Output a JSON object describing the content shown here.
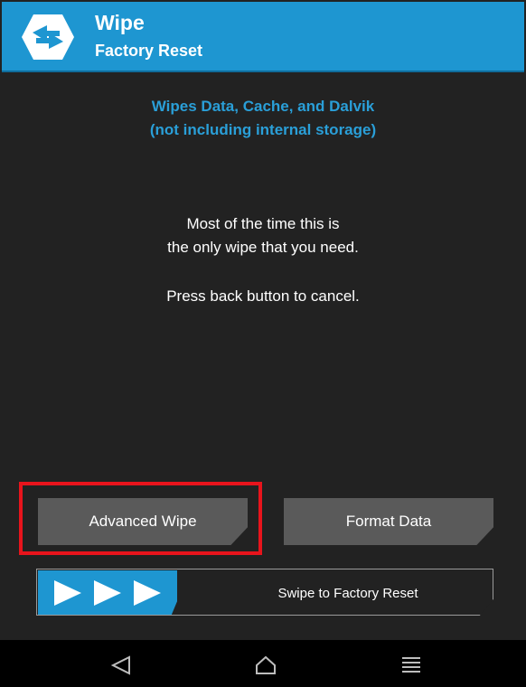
{
  "header": {
    "title": "Wipe",
    "subtitle": "Factory Reset",
    "logo_icon": "twrp-logo-icon"
  },
  "info": {
    "line1": "Wipes Data, Cache, and Dalvik",
    "line2": "(not including internal storage)"
  },
  "message": {
    "line1": "Most of the time this is",
    "line2": "the only wipe that you need.",
    "line3": "Press back button to cancel."
  },
  "buttons": {
    "advanced_wipe": "Advanced Wipe",
    "format_data": "Format Data"
  },
  "swipe": {
    "label": "Swipe to Factory Reset",
    "icon": "triple-arrow-icon"
  },
  "navbar": {
    "back_icon": "back-icon",
    "home_icon": "home-icon",
    "menu_icon": "menu-icon"
  },
  "colors": {
    "accent": "#1e96d1",
    "background": "#222222",
    "button": "#5a5a5a",
    "highlight": "#e8141c"
  }
}
